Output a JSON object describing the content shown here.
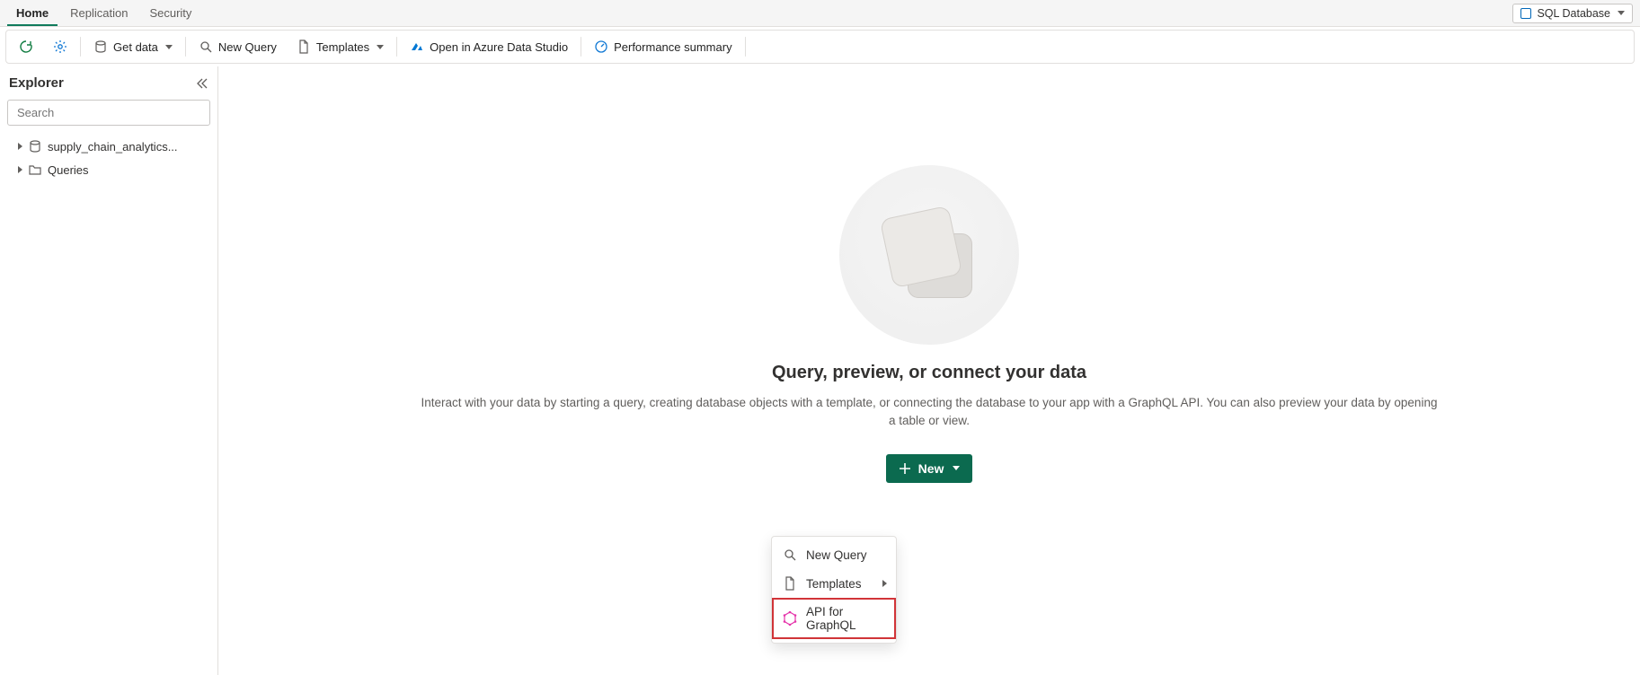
{
  "tabs": {
    "home": "Home",
    "replication": "Replication",
    "security": "Security"
  },
  "db_badge": "SQL Database",
  "toolbar": {
    "get_data": "Get data",
    "new_query": "New Query",
    "templates": "Templates",
    "open_ads": "Open in Azure Data Studio",
    "perf_summary": "Performance summary"
  },
  "explorer": {
    "title": "Explorer",
    "search_placeholder": "Search",
    "items": {
      "db": "supply_chain_analytics...",
      "queries": "Queries"
    }
  },
  "hero": {
    "title": "Query, preview, or connect your data",
    "subtitle": "Interact with your data by starting a query, creating database objects with a template, or connecting the database to your app with a GraphQL API. You can also preview your data by opening a table or view.",
    "new_button": "New"
  },
  "menu": {
    "new_query": "New Query",
    "templates": "Templates",
    "api_graphql": "API for GraphQL"
  }
}
